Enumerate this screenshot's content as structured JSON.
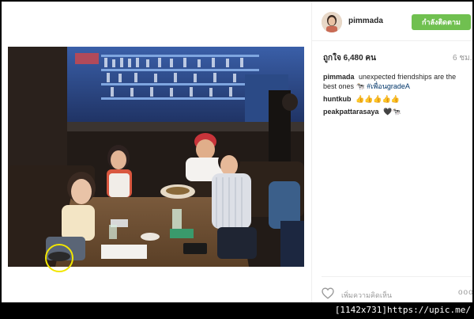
{
  "post": {
    "username": "pimmada",
    "follow_label": "กำลังติดตาม",
    "likes_text": "ถูกใจ 6,480 คน",
    "time_ago": "6 ชม.",
    "caption": {
      "user": "pimmada",
      "text": "unexpected friendships are the best ones",
      "emoji": "🐄",
      "tag": "#เพื่อนgradeA"
    },
    "comments": [
      {
        "user": "huntkub",
        "text": "👍👍👍👍👍"
      },
      {
        "user": "peakpattarasaya",
        "text": "🖤🐄"
      }
    ],
    "add_comment_placeholder": "เพิ่มความคิดเห็น",
    "more_label": "ooo"
  },
  "footer": {
    "watermark": "[1142x731]https://upic.me/"
  },
  "colors": {
    "follow_button": "#70c050",
    "highlight_circle": "#f2e600",
    "hashtag": "#003569"
  }
}
